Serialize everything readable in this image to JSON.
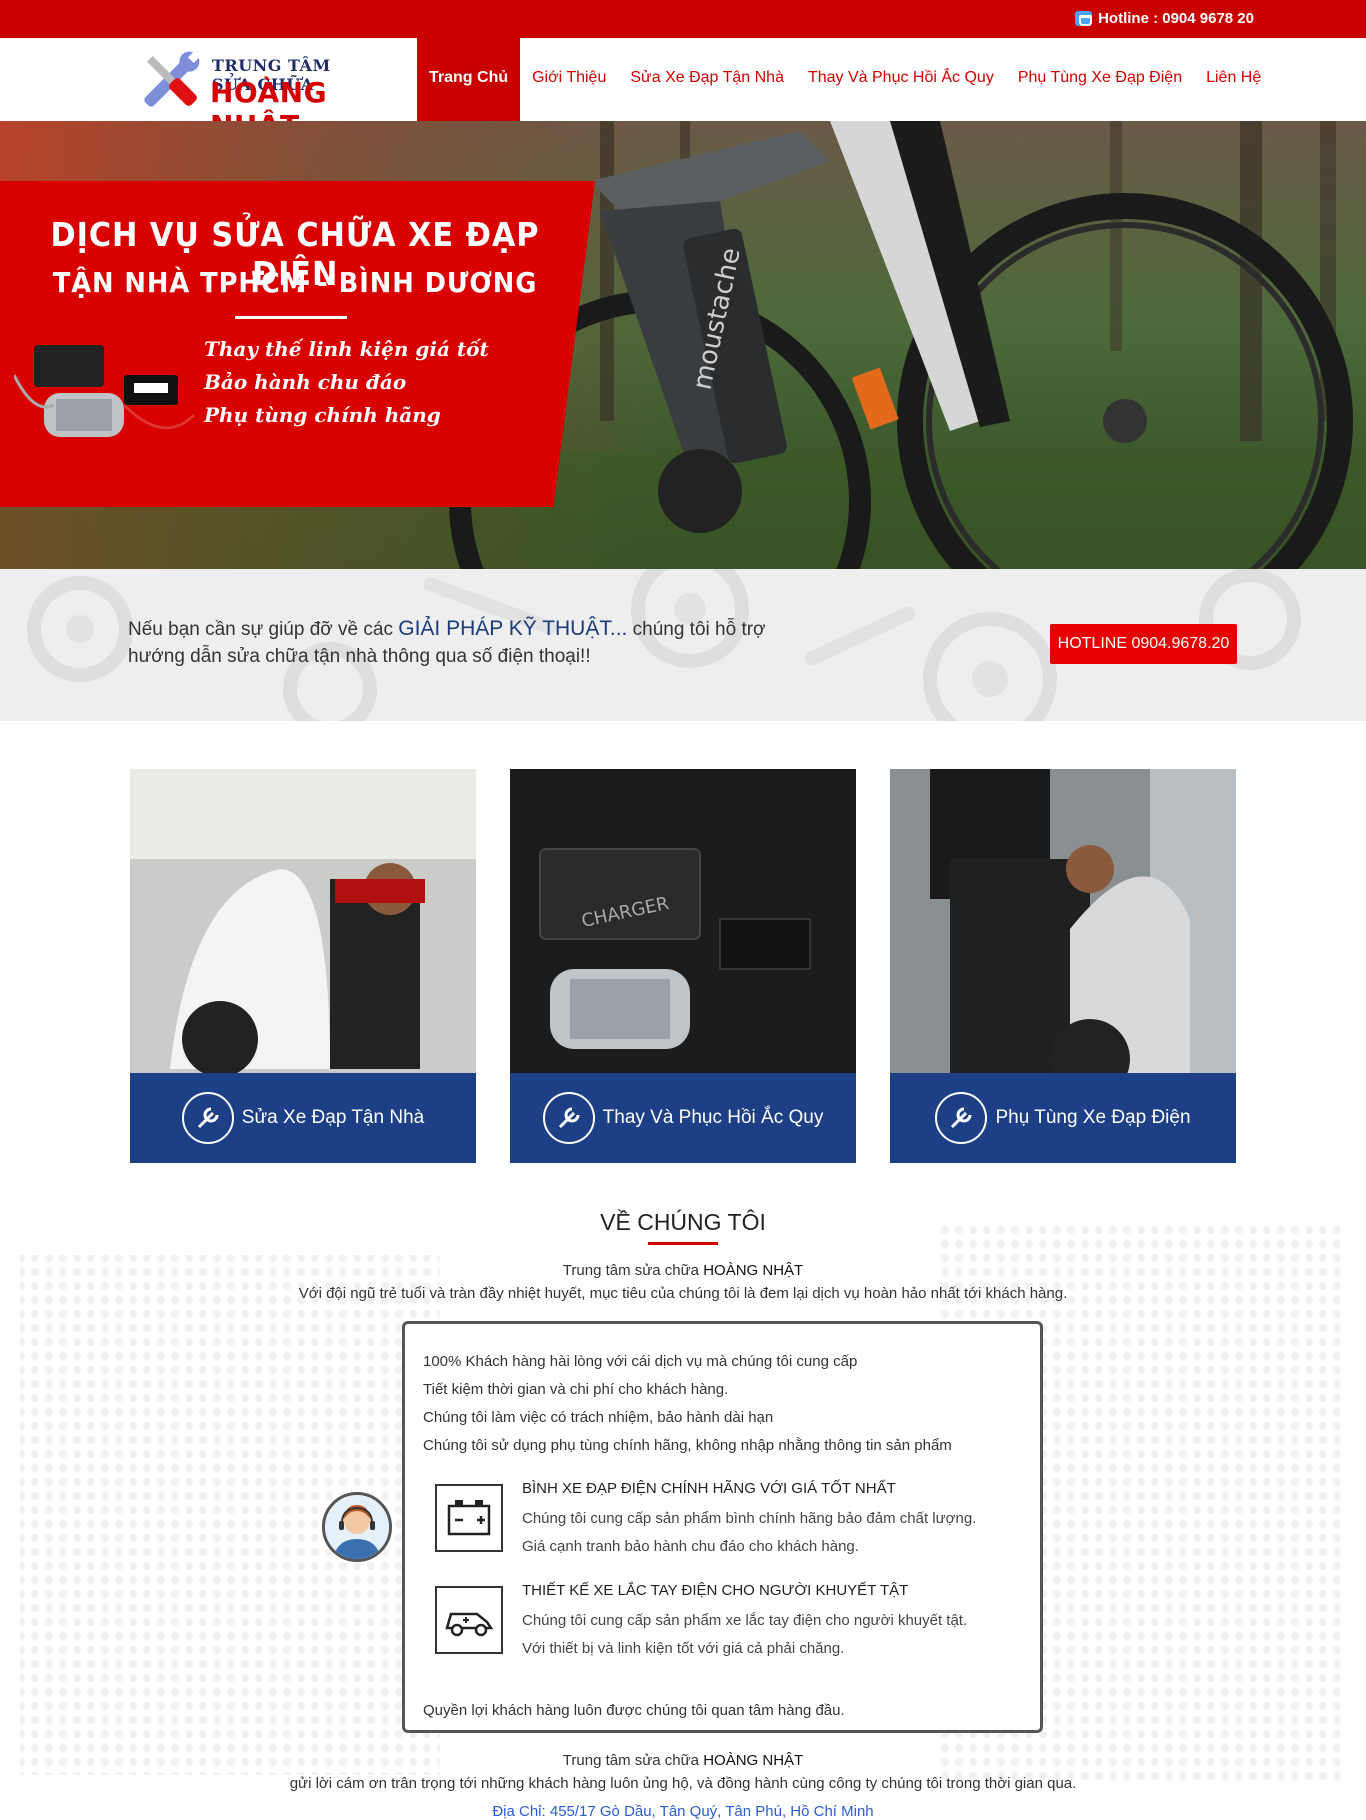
{
  "topbar": {
    "hotline": "Hotline : 0904 9678 20",
    "icon": "phone-icon"
  },
  "logo": {
    "line1": "TRUNG TÂM SỬA CHỮA",
    "line2": "HOÀNG NHẬT",
    "icon": "wrench-screwdriver-icon"
  },
  "nav": [
    {
      "label": "Trang Chủ",
      "active": true
    },
    {
      "label": "Giới Thiệu"
    },
    {
      "label": "Sửa Xe Đạp Tận Nhà"
    },
    {
      "label": "Thay Và Phục Hồi Ắc Quy"
    },
    {
      "label": "Phụ Tùng Xe Đạp Điện"
    },
    {
      "label": "Liên Hệ"
    }
  ],
  "hero": {
    "title1": "DỊCH VỤ SỬA CHỮA XE ĐẠP ĐIỆN",
    "title2": "TẬN NHÀ TPHCM - BÌNH DƯƠNG",
    "bullets": [
      "Thay thế linh kiện giá tốt",
      "Bảo hành chu đáo",
      "Phụ tùng chính hãng"
    ],
    "bike_brand": "moustache"
  },
  "cta": {
    "text_before": "Nếu bạn cần sự giúp đỡ về các ",
    "highlight": "GIẢI PHÁP KỸ THUẬT...",
    "text_after": " chúng tôi hỗ trợ hướng dẫn sửa chữa tận nhà thông qua số điện thoại!!",
    "button": "HOTLINE 0904.9678.20"
  },
  "services": [
    {
      "label": "Sửa Xe Đạp Tận Nhà"
    },
    {
      "label": "Thay Và Phục Hồi Ắc Quy"
    },
    {
      "label": "Phụ Tùng Xe Đạp Điện"
    }
  ],
  "about": {
    "heading": "VỀ CHÚNG TÔI",
    "intro_prefix": "Trung tâm sửa chữa ",
    "brand": "HOÀNG NHẬT",
    "intro_line2": "Với đội ngũ trẻ tuổi và tràn đầy nhiệt huyết, mục tiêu của chúng tôi là đem lại dịch vụ hoàn hảo nhất tới khách hàng.",
    "points": [
      "100% Khách hàng hài lòng với cái dịch vụ mà chúng tôi cung cấp",
      "Tiết kiệm thời gian và chi phí cho khách hàng.",
      "Chúng tôi làm việc có trách nhiệm, bảo hành dài hạn",
      "Chúng tôi sử dụng phụ tùng chính hãng, không nhập nhằng thông tin sản phẩm"
    ],
    "features": [
      {
        "title": "BÌNH XE ĐẠP ĐIỆN CHÍNH HÃNG VỚI GIÁ TỐT NHẤT",
        "desc1": "Chúng tôi cung cấp sản phẩm bình chính hãng bảo đảm chất lượng.",
        "desc2": "Giá cạnh tranh bảo hành chu đáo cho khách hàng."
      },
      {
        "title": "THIẾT KẾ XE LẮC TAY ĐIỆN CHO NGƯỜI KHUYẾT TẬT",
        "desc1": "Chúng tôi cung cấp sản phẩm xe lắc tay điện cho người khuyết tật.",
        "desc2": "Với thiết bị và linh kiện tốt với giá cả phải chăng."
      }
    ],
    "closing": "Quyền lợi khách hàng luôn được chúng tôi quan tâm hàng đầu.",
    "outro_prefix": "Trung tâm sửa chữa ",
    "outro_line2": "gửi lời cám ơn trân trọng tới những khách hàng luôn ủng hộ, và đồng hành cùng công ty chúng tôi trong thời gian qua.",
    "address": "Địa Chỉ: 455/17 Gò Dầu, Tân Quý, Tân Phú, Hồ Chí Minh"
  }
}
